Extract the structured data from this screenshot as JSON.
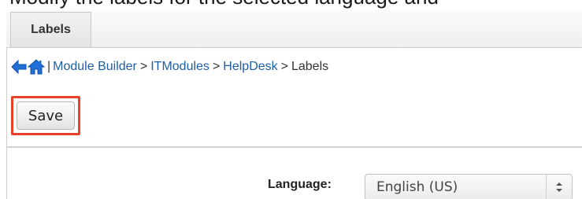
{
  "header": {
    "cut_off_text": "Modify the labels for the selected language and"
  },
  "tabs": [
    {
      "label": "Labels"
    }
  ],
  "breadcrumb": {
    "items": [
      {
        "label": "Module Builder"
      },
      {
        "label": "ITModules"
      },
      {
        "label": "HelpDesk"
      },
      {
        "label": "Labels"
      }
    ],
    "bar": "|",
    "separator": ">"
  },
  "toolbar": {
    "save_label": "Save"
  },
  "language": {
    "label": "Language:",
    "selected": "English (US)"
  },
  "colors": {
    "link": "#1f5fa8",
    "highlight": "#e8412b",
    "back_arrow": "#1f6fd6",
    "home_icon": "#1f6fd6"
  }
}
